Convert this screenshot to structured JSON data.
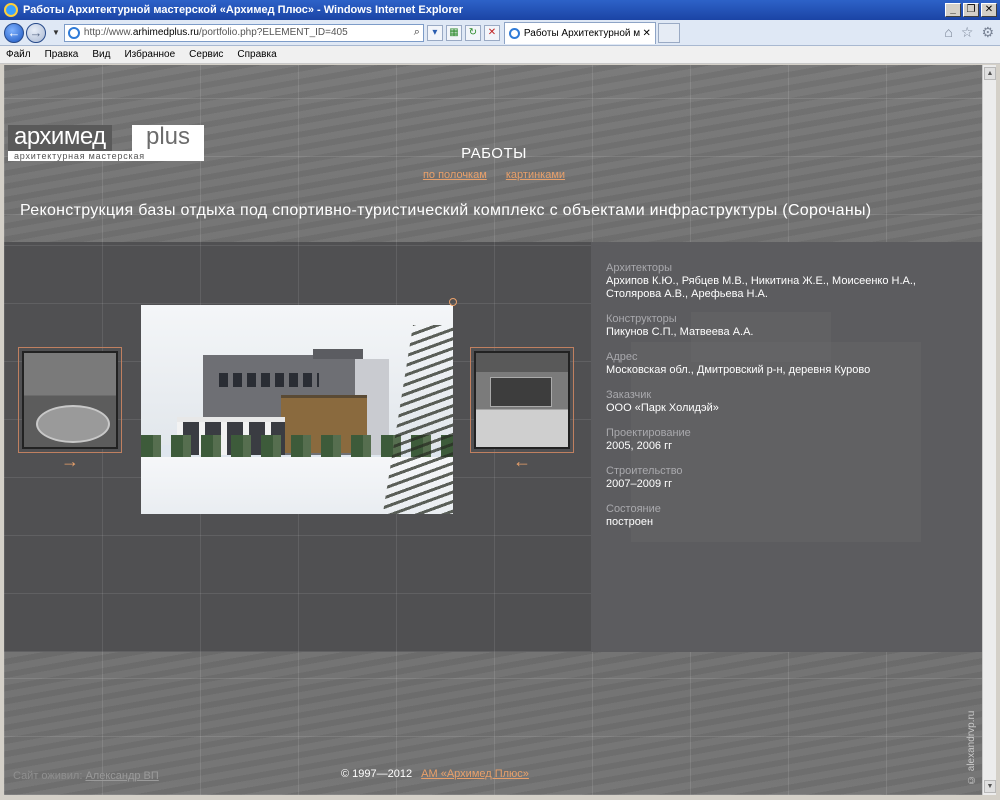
{
  "window": {
    "title": "Работы Архитектурной мастерской «Архимед Плюс» - Windows Internet Explorer",
    "buttons": [
      "_",
      "❐",
      "✕"
    ]
  },
  "browser": {
    "url_prefix": "http://www.",
    "url_domain": "arhimedplus.ru",
    "url_path": "/portfolio.php?ELEMENT_ID=405",
    "tab_title": "Работы Архитектурной ма...",
    "tab_close": "✕",
    "menu": [
      "Файл",
      "Правка",
      "Вид",
      "Избранное",
      "Сервис",
      "Справка"
    ],
    "icons": [
      "home-icon",
      "favorites-star-icon",
      "tools-gear-icon"
    ]
  },
  "header": {
    "logo_word1": "архимед",
    "logo_word2": "plus",
    "logo_tagline": "архитектурная мастерская",
    "section_title": "РАБОТЫ",
    "view_links": [
      "по полочкам",
      "картинками"
    ]
  },
  "project": {
    "title": "Реконструкция базы отдыха под спортивно-туристический комплекс с объектами инфраструктуры (Сорочаны)",
    "prev_arrow": "→",
    "next_arrow": "←",
    "fields": [
      {
        "label": "Архитекторы",
        "value": "Архипов К.Ю., Рябцев М.В., Никитина Ж.Е., Моисеенко Н.А., Столярова А.В., Арефьева Н.А."
      },
      {
        "label": "Конструкторы",
        "value": "Пикунов С.П., Матвеева А.А."
      },
      {
        "label": "Адрес",
        "value": "Московская обл., Дмитровский р-н, деревня Курово"
      },
      {
        "label": "Заказчик",
        "value": "ООО «Парк Холидэй»"
      },
      {
        "label": "Проектирование",
        "value": "2005, 2006 гг"
      },
      {
        "label": "Строительство",
        "value": "2007–2009 гг"
      },
      {
        "label": "Состояние",
        "value": "построен"
      }
    ]
  },
  "footer": {
    "credit_label": "Сайт оживил:",
    "credit_link": "Александр ВП",
    "copyright": "© 1997—2012",
    "copyright_link": "АМ «Архимед Плюс»",
    "watermark": "© alexandrvp.ru"
  }
}
